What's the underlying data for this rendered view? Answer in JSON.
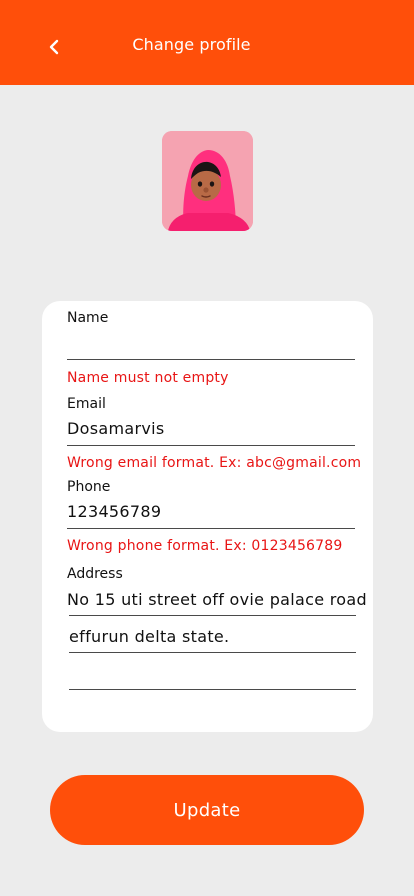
{
  "colors": {
    "accent": "#ff4f0a",
    "error": "#e81515",
    "background": "#ececec",
    "card": "#ffffff"
  },
  "header": {
    "title": "Change profile",
    "back_icon": "chevron-left-icon"
  },
  "avatar": {
    "icon": "user-avatar-3d-character"
  },
  "form": {
    "name": {
      "label": "Name",
      "value": "",
      "error": "Name must not empty"
    },
    "email": {
      "label": "Email",
      "value": "Dosamarvis",
      "error": "Wrong email format. Ex: abc@gmail.com"
    },
    "phone": {
      "label": "Phone",
      "value": "123456789",
      "error": "Wrong phone format. Ex: 0123456789"
    },
    "address": {
      "label": "Address",
      "line1": "No 15 uti street off ovie palace road",
      "line2": "effurun delta state.",
      "line3": ""
    }
  },
  "update_button": {
    "label": "Update"
  }
}
